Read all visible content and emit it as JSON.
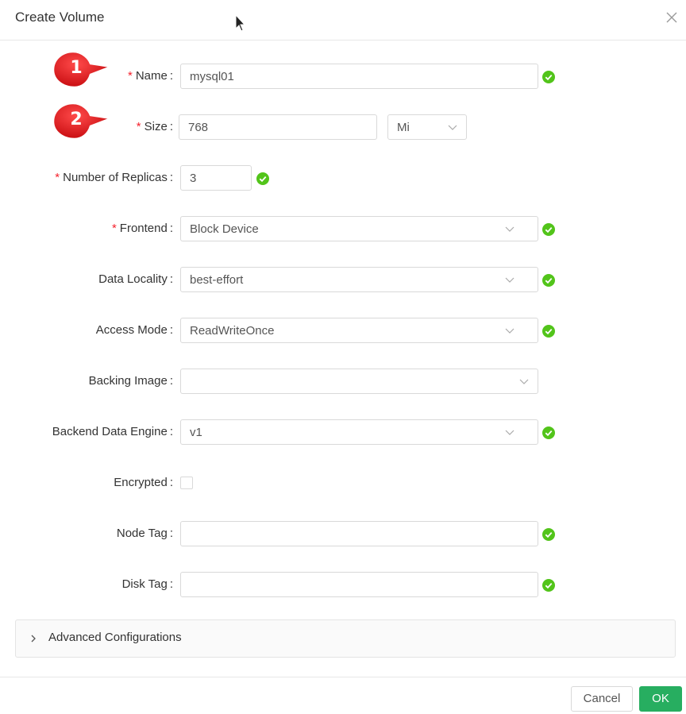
{
  "dialog": {
    "title": "Create Volume"
  },
  "annotations": {
    "badge1": "1",
    "badge2": "2"
  },
  "form": {
    "name": {
      "label": "Name",
      "value": "mysql01",
      "required": true
    },
    "size": {
      "label": "Size",
      "value": "768",
      "unit": "Mi",
      "required": true
    },
    "replicas": {
      "label": "Number of Replicas",
      "value": "3",
      "required": true
    },
    "frontend": {
      "label": "Frontend",
      "value": "Block Device",
      "required": true
    },
    "data_locality": {
      "label": "Data Locality",
      "value": "best-effort"
    },
    "access_mode": {
      "label": "Access Mode",
      "value": "ReadWriteOnce"
    },
    "backing_image": {
      "label": "Backing Image",
      "value": ""
    },
    "backend_engine": {
      "label": "Backend Data Engine",
      "value": "v1"
    },
    "encrypted": {
      "label": "Encrypted",
      "checked": false
    },
    "node_tag": {
      "label": "Node Tag",
      "value": ""
    },
    "disk_tag": {
      "label": "Disk Tag",
      "value": ""
    },
    "required_mark": "*",
    "colon": ":"
  },
  "advanced": {
    "label": "Advanced Configurations"
  },
  "footer": {
    "cancel_label": "Cancel",
    "ok_label": "OK"
  },
  "colors": {
    "success": "#52c41a",
    "primary": "#27ae60",
    "required": "#f5222d",
    "badge": "#e8151b"
  }
}
